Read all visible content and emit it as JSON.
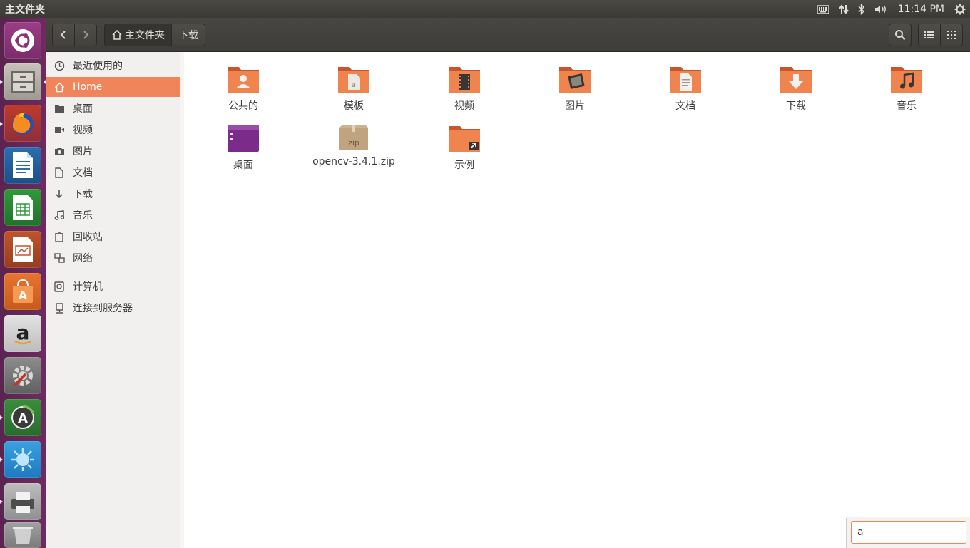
{
  "topbar": {
    "app_title": "主文件夹",
    "clock": "11:14 PM",
    "indicators": [
      "keyboard-icon",
      "network-icon",
      "bluetooth-icon",
      "volume-icon",
      "power-gear-icon"
    ]
  },
  "launcher": {
    "items": [
      "dash-home",
      "files",
      "firefox",
      "libreoffice-writer",
      "libreoffice-calc",
      "libreoffice-impress",
      "ubuntu-software",
      "amazon",
      "system-settings",
      "software-updater",
      "unknown-app",
      "printer",
      "trash"
    ]
  },
  "header": {
    "back_label": "back",
    "forward_label": "forward",
    "breadcrumb_home": "主文件夹",
    "breadcrumb_current": "下载"
  },
  "sidebar": {
    "items": [
      {
        "label": "最近使用的",
        "icon": "clock-icon"
      },
      {
        "label": "Home",
        "icon": "home-icon",
        "active": true
      },
      {
        "label": "桌面",
        "icon": "desktop-icon"
      },
      {
        "label": "视频",
        "icon": "video-icon"
      },
      {
        "label": "图片",
        "icon": "camera-icon"
      },
      {
        "label": "文档",
        "icon": "document-icon"
      },
      {
        "label": "下载",
        "icon": "download-icon"
      },
      {
        "label": "音乐",
        "icon": "music-icon"
      },
      {
        "label": "回收站",
        "icon": "trash-icon"
      },
      {
        "label": "网络",
        "icon": "network-icon"
      }
    ],
    "devices": [
      {
        "label": "计算机",
        "icon": "computer-icon"
      },
      {
        "label": "连接到服务器",
        "icon": "server-icon"
      }
    ]
  },
  "files": [
    {
      "name": "公共的",
      "type": "folder-public"
    },
    {
      "name": "模板",
      "type": "folder-templates"
    },
    {
      "name": "视频",
      "type": "folder-videos"
    },
    {
      "name": "图片",
      "type": "folder-pictures"
    },
    {
      "name": "文档",
      "type": "folder-documents"
    },
    {
      "name": "下载",
      "type": "folder-downloads"
    },
    {
      "name": "音乐",
      "type": "folder-music"
    },
    {
      "name": "桌面",
      "type": "folder-desktop"
    },
    {
      "name": "opencv-3.4.1.zip",
      "type": "zip-archive"
    },
    {
      "name": "示例",
      "type": "folder-link"
    }
  ],
  "typeahead": {
    "value": "a"
  },
  "colors": {
    "accent": "#f0845a",
    "launcher": "#6e2b5f",
    "headerbar": "#3e3d39"
  }
}
